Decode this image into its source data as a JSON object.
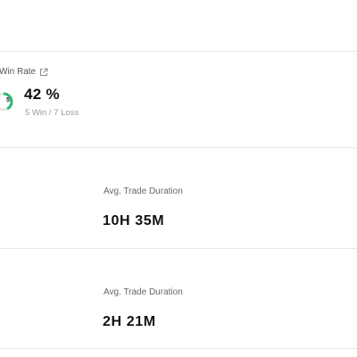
{
  "win_rate": {
    "title": "Win Rate",
    "value": "42 %",
    "fraction": 0.42,
    "gauge_count": "5",
    "subtitle": "5 Win / 7 Loss",
    "colors": {
      "win": "#2bb673",
      "loss": "#e6e6e6"
    }
  },
  "stats": [
    {
      "label": "Avg. Trade Duration",
      "value": "10H 35M"
    },
    {
      "label": "Avg. Trade Duration",
      "value": "2H 21M"
    }
  ]
}
